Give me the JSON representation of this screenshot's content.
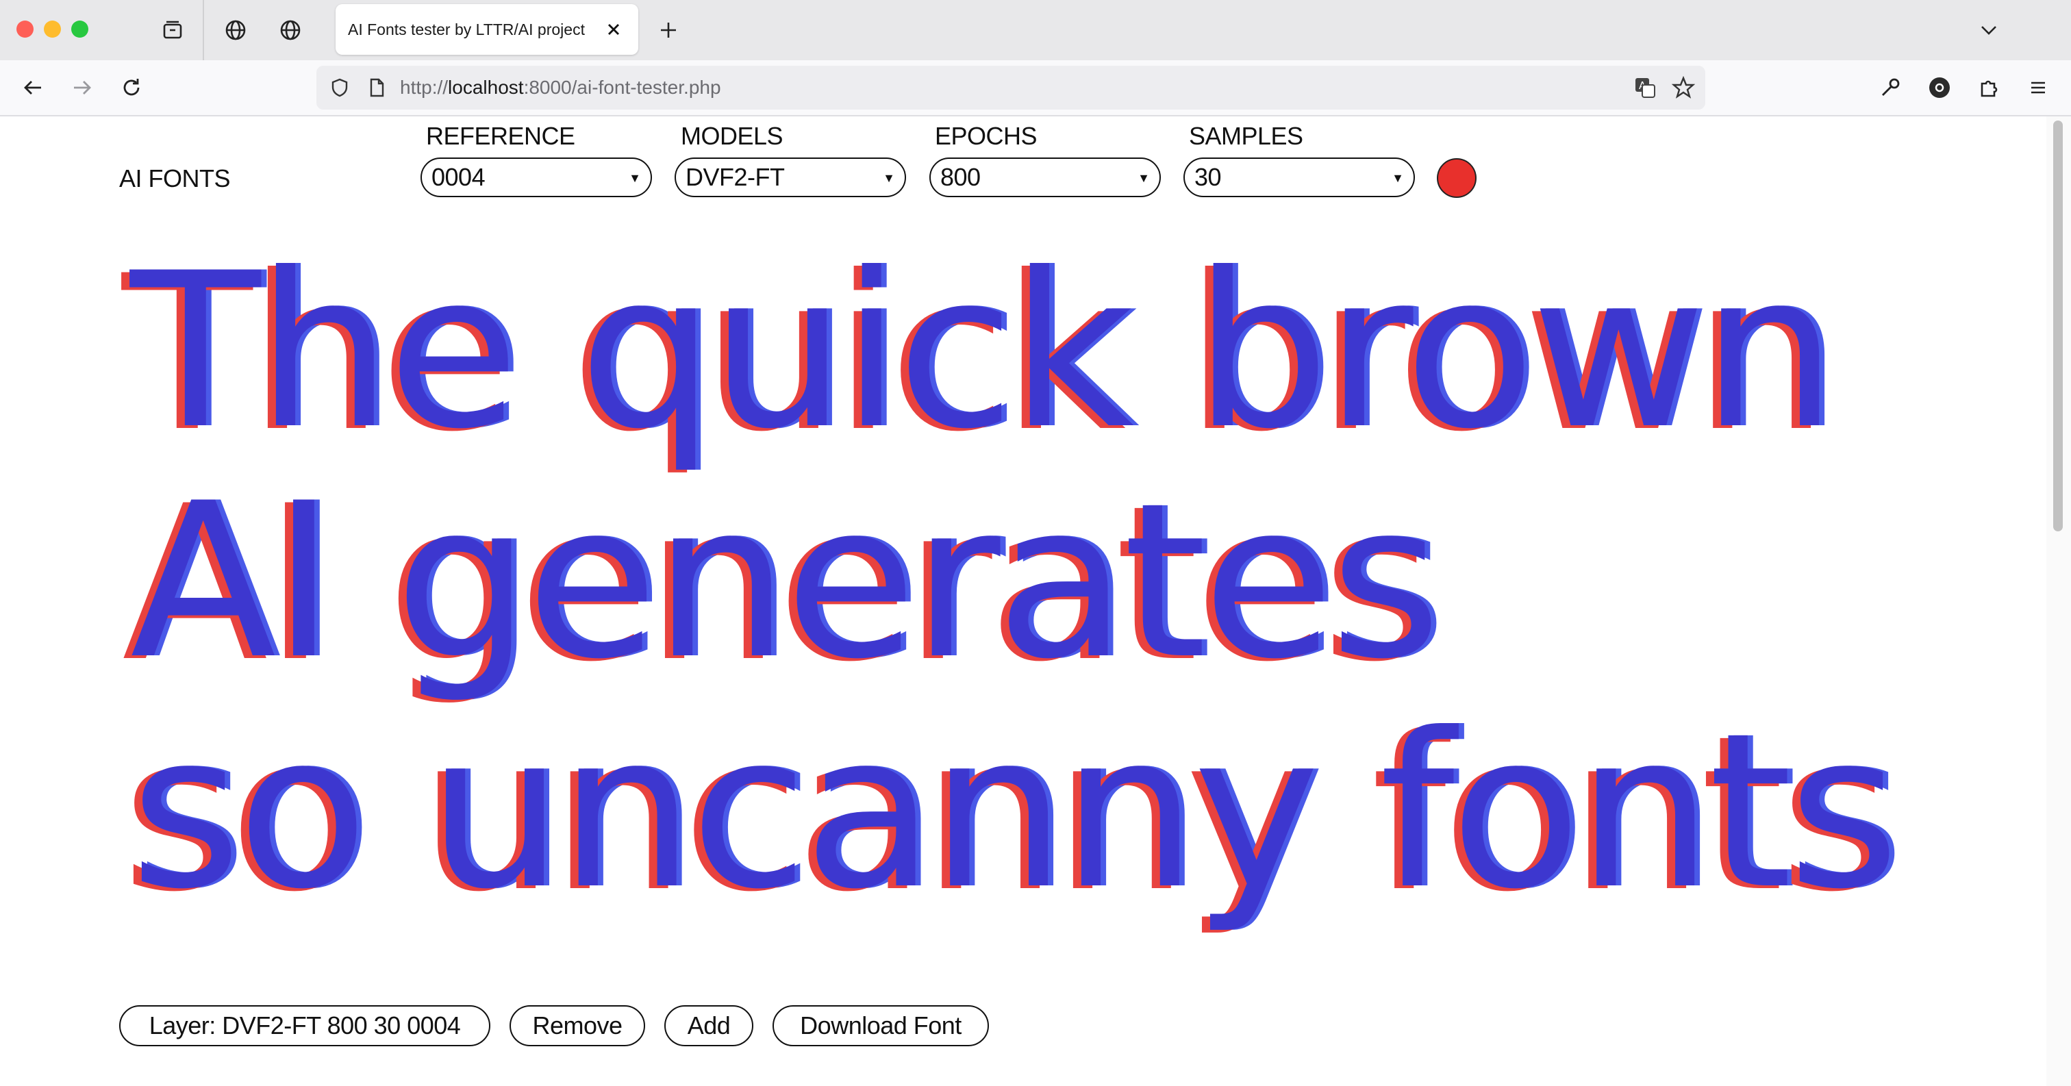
{
  "browser": {
    "tab_title": "AI Fonts tester by LTTR/AI project",
    "url_prefix": "http://",
    "url_host": "localhost",
    "url_rest": ":8000/ai-font-tester.php"
  },
  "app": {
    "brand": "AI FONTS",
    "controls": [
      {
        "label": "REFERENCE",
        "value": "0004"
      },
      {
        "label": "MODELS",
        "value": "DVF2-FT"
      },
      {
        "label": "EPOCHS",
        "value": "800"
      },
      {
        "label": "SAMPLES",
        "value": "30"
      }
    ],
    "record_color": "#e8302c"
  },
  "specimen": {
    "lines": [
      "The quick brown",
      "AI generates",
      "so uncanny fonts"
    ],
    "colors": {
      "main": "#3d37cf",
      "red_layer": "#e8423f",
      "blue_layer": "#4a5ae8"
    }
  },
  "footer": {
    "layer_label": "Layer: DVF2-FT 800 30 0004",
    "remove_label": "Remove",
    "add_label": "Add",
    "download_label": "Download Font"
  }
}
